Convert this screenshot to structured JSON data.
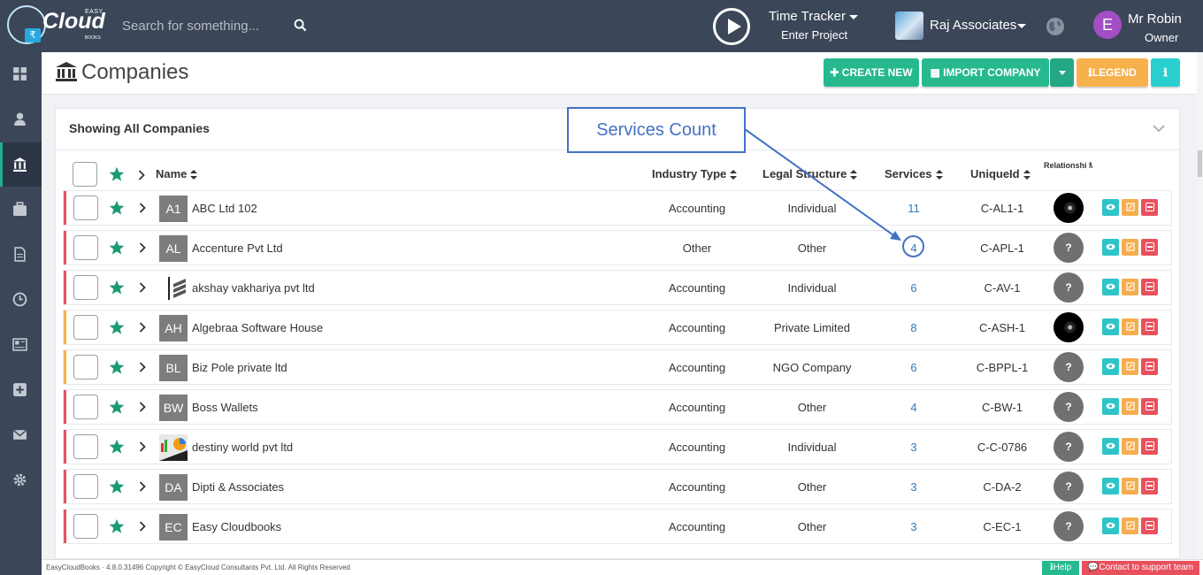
{
  "brand": {
    "easy": "EASY",
    "cloud": "Cloud",
    "books": "BOOKS",
    "rupee": "₹"
  },
  "search": {
    "placeholder": "Search for something..."
  },
  "time_tracker": {
    "title": "Time Tracker",
    "subtitle": "Enter Project"
  },
  "company_switcher": {
    "name": "Raj Associates"
  },
  "user": {
    "initial": "E",
    "name": "Mr Robin",
    "role": "Owner"
  },
  "page": {
    "title": "Companies"
  },
  "toolbar": {
    "create_label": "✚ CREATE NEW",
    "import_label": "▦ IMPORT COMPANY",
    "legend_label": "ℹLEGEND",
    "info_label": "ℹ"
  },
  "panel": {
    "title": "Showing All Companies"
  },
  "columns": {
    "name": "Name",
    "industry": "Industry Type",
    "legal": "Legal Structure",
    "services": "Services",
    "unique": "UniqueId",
    "rm": "Relationshi Manager"
  },
  "rows": [
    {
      "initials": "A1",
      "name": "ABC Ltd 102",
      "industry": "Accounting",
      "legal": "Individual",
      "services": "11",
      "uid": "C-AL1-1",
      "rm": "",
      "bar": "#e25562"
    },
    {
      "initials": "AL",
      "name": "Accenture Pvt Ltd",
      "industry": "Other",
      "legal": "Other",
      "services": "4",
      "uid": "C-APL-1",
      "rm": "?",
      "bar": "#e25562"
    },
    {
      "initials": "",
      "name": "akshay vakhariya pvt ltd",
      "industry": "Accounting",
      "legal": "Individual",
      "services": "6",
      "uid": "C-AV-1",
      "rm": "?",
      "bar": "#e25562"
    },
    {
      "initials": "AH",
      "name": "Algebraa Software House",
      "industry": "Accounting",
      "legal": "Private Limited",
      "services": "8",
      "uid": "C-ASH-1",
      "rm": "",
      "bar": "#f6b14c"
    },
    {
      "initials": "BL",
      "name": "Biz Pole private ltd",
      "industry": "Accounting",
      "legal": "NGO Company",
      "services": "6",
      "uid": "C-BPPL-1",
      "rm": "?",
      "bar": "#f6b14c"
    },
    {
      "initials": "BW",
      "name": "Boss Wallets",
      "industry": "Accounting",
      "legal": "Other",
      "services": "4",
      "uid": "C-BW-1",
      "rm": "?",
      "bar": "#e25562"
    },
    {
      "initials": "",
      "name": "destiny world pvt ltd",
      "industry": "Accounting",
      "legal": "Individual",
      "services": "3",
      "uid": "C-C-0786",
      "rm": "?",
      "bar": "#e25562"
    },
    {
      "initials": "DA",
      "name": "Dipti & Associates",
      "industry": "Accounting",
      "legal": "Other",
      "services": "3",
      "uid": "C-DA-2",
      "rm": "?",
      "bar": "#e25562"
    },
    {
      "initials": "EC",
      "name": "Easy Cloudbooks",
      "industry": "Accounting",
      "legal": "Other",
      "services": "3",
      "uid": "C-EC-1",
      "rm": "?",
      "bar": "#e25562"
    }
  ],
  "annotation": {
    "callout": "Services Count"
  },
  "footer": {
    "text": "EasyCloudBooks · 4.8.0.31496  Copyright © EasyCloud Consultants Pvt. Ltd. All Rights Reserved",
    "help": "ℹHelp",
    "support": "💬Contact to support team"
  },
  "colors": {
    "topbar": "#3b4658",
    "accent": "#26b98f",
    "warning": "#f6b14c",
    "danger": "#e9505d",
    "info": "#2fc4c8"
  }
}
